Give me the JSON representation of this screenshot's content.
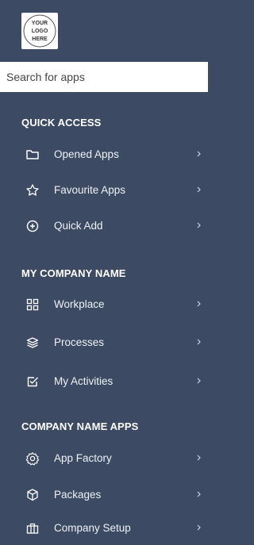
{
  "logo": {
    "text_lines": [
      "YOUR",
      "LOGO",
      "HERE"
    ]
  },
  "search": {
    "placeholder": "Search for apps",
    "value": ""
  },
  "sections": [
    {
      "title": "QUICK ACCESS",
      "items": [
        {
          "label": "Opened Apps",
          "icon": "folder-icon"
        },
        {
          "label": "Favourite Apps",
          "icon": "star-icon"
        },
        {
          "label": "Quick Add",
          "icon": "plus-circle-icon"
        }
      ]
    },
    {
      "title": "MY COMPANY NAME",
      "items": [
        {
          "label": "Workplace",
          "icon": "grid-icon"
        },
        {
          "label": "Processes",
          "icon": "layers-icon"
        },
        {
          "label": "My Activities",
          "icon": "checkbox-icon"
        }
      ]
    },
    {
      "title": "COMPANY NAME APPS",
      "items": [
        {
          "label": "App Factory",
          "icon": "gear-icon"
        },
        {
          "label": "Packages",
          "icon": "package-icon"
        },
        {
          "label": "Company Setup",
          "icon": "building-icon"
        }
      ]
    }
  ],
  "colors": {
    "sidebar_bg": "#3d4a63",
    "text": "#ffffff",
    "search_bg": "#ffffff"
  }
}
